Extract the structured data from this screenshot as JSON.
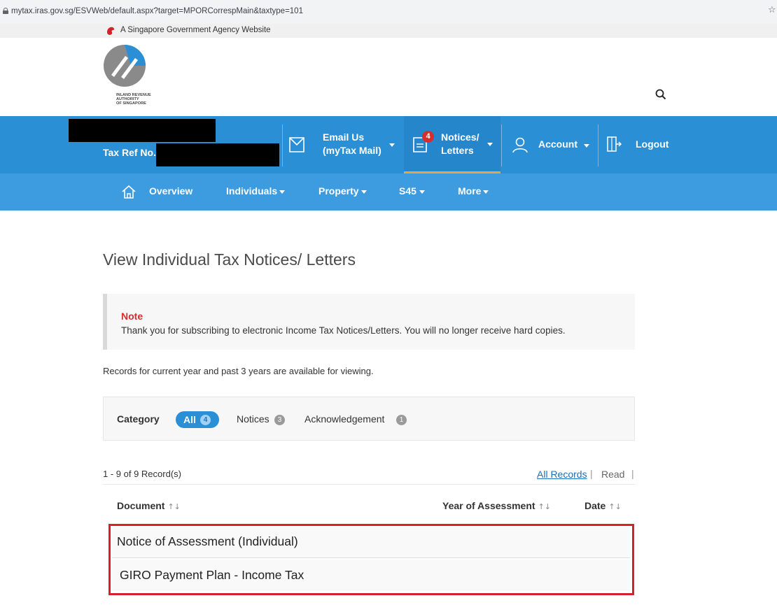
{
  "browser": {
    "url": "mytax.iras.gov.sg/ESVWeb/default.aspx?target=MPORCorrespMain&taxtype=101"
  },
  "gov_banner": {
    "text": "A Singapore Government Agency Website"
  },
  "logo": {
    "text_line1": "INLAND REVENUE",
    "text_line2": "AUTHORITY",
    "text_line3": "OF SINGAPORE"
  },
  "top_nav": {
    "tax_ref_label": "Tax Ref No.",
    "email_line1": "Email Us",
    "email_line2": "(myTax Mail)",
    "notices_badge": "4",
    "notices_line1": "Notices/",
    "notices_line2": "Letters",
    "account_label": "Account",
    "logout_label": "Logout"
  },
  "sub_nav": {
    "overview": "Overview",
    "individuals": "Individuals",
    "property": "Property",
    "s45": "S45",
    "more": "More"
  },
  "page": {
    "title": "View Individual Tax Notices/ Letters"
  },
  "note": {
    "title": "Note",
    "text": "Thank you for subscribing to electronic Income Tax Notices/Letters. You will no longer receive hard copies."
  },
  "records_info": "Records for current year and past 3 years are available for viewing.",
  "filter": {
    "label": "Category",
    "options": [
      {
        "label": "All",
        "count": "4",
        "selected": true
      },
      {
        "label": "Notices",
        "count": "3",
        "selected": false
      },
      {
        "label": "Acknowledgement",
        "count": "1",
        "selected": false
      }
    ]
  },
  "records": {
    "count_text": "1 - 9 of 9 Record(s)",
    "all_records": "All Records",
    "read": "Read"
  },
  "table": {
    "columns": [
      "Document",
      "Year of Assessment",
      "Date"
    ],
    "sort_glyph": "↑↓",
    "rows": [
      {
        "document": "Notice of Assessment (Individual)"
      },
      {
        "document": "GIRO Payment Plan - Income Tax"
      }
    ]
  },
  "colors": {
    "nav_primary": "#2b8fd6",
    "nav_secondary": "#3d9be0",
    "note_red": "#d32f2f",
    "highlight_red": "#d6202c",
    "link_blue": "#1a6fb8"
  }
}
